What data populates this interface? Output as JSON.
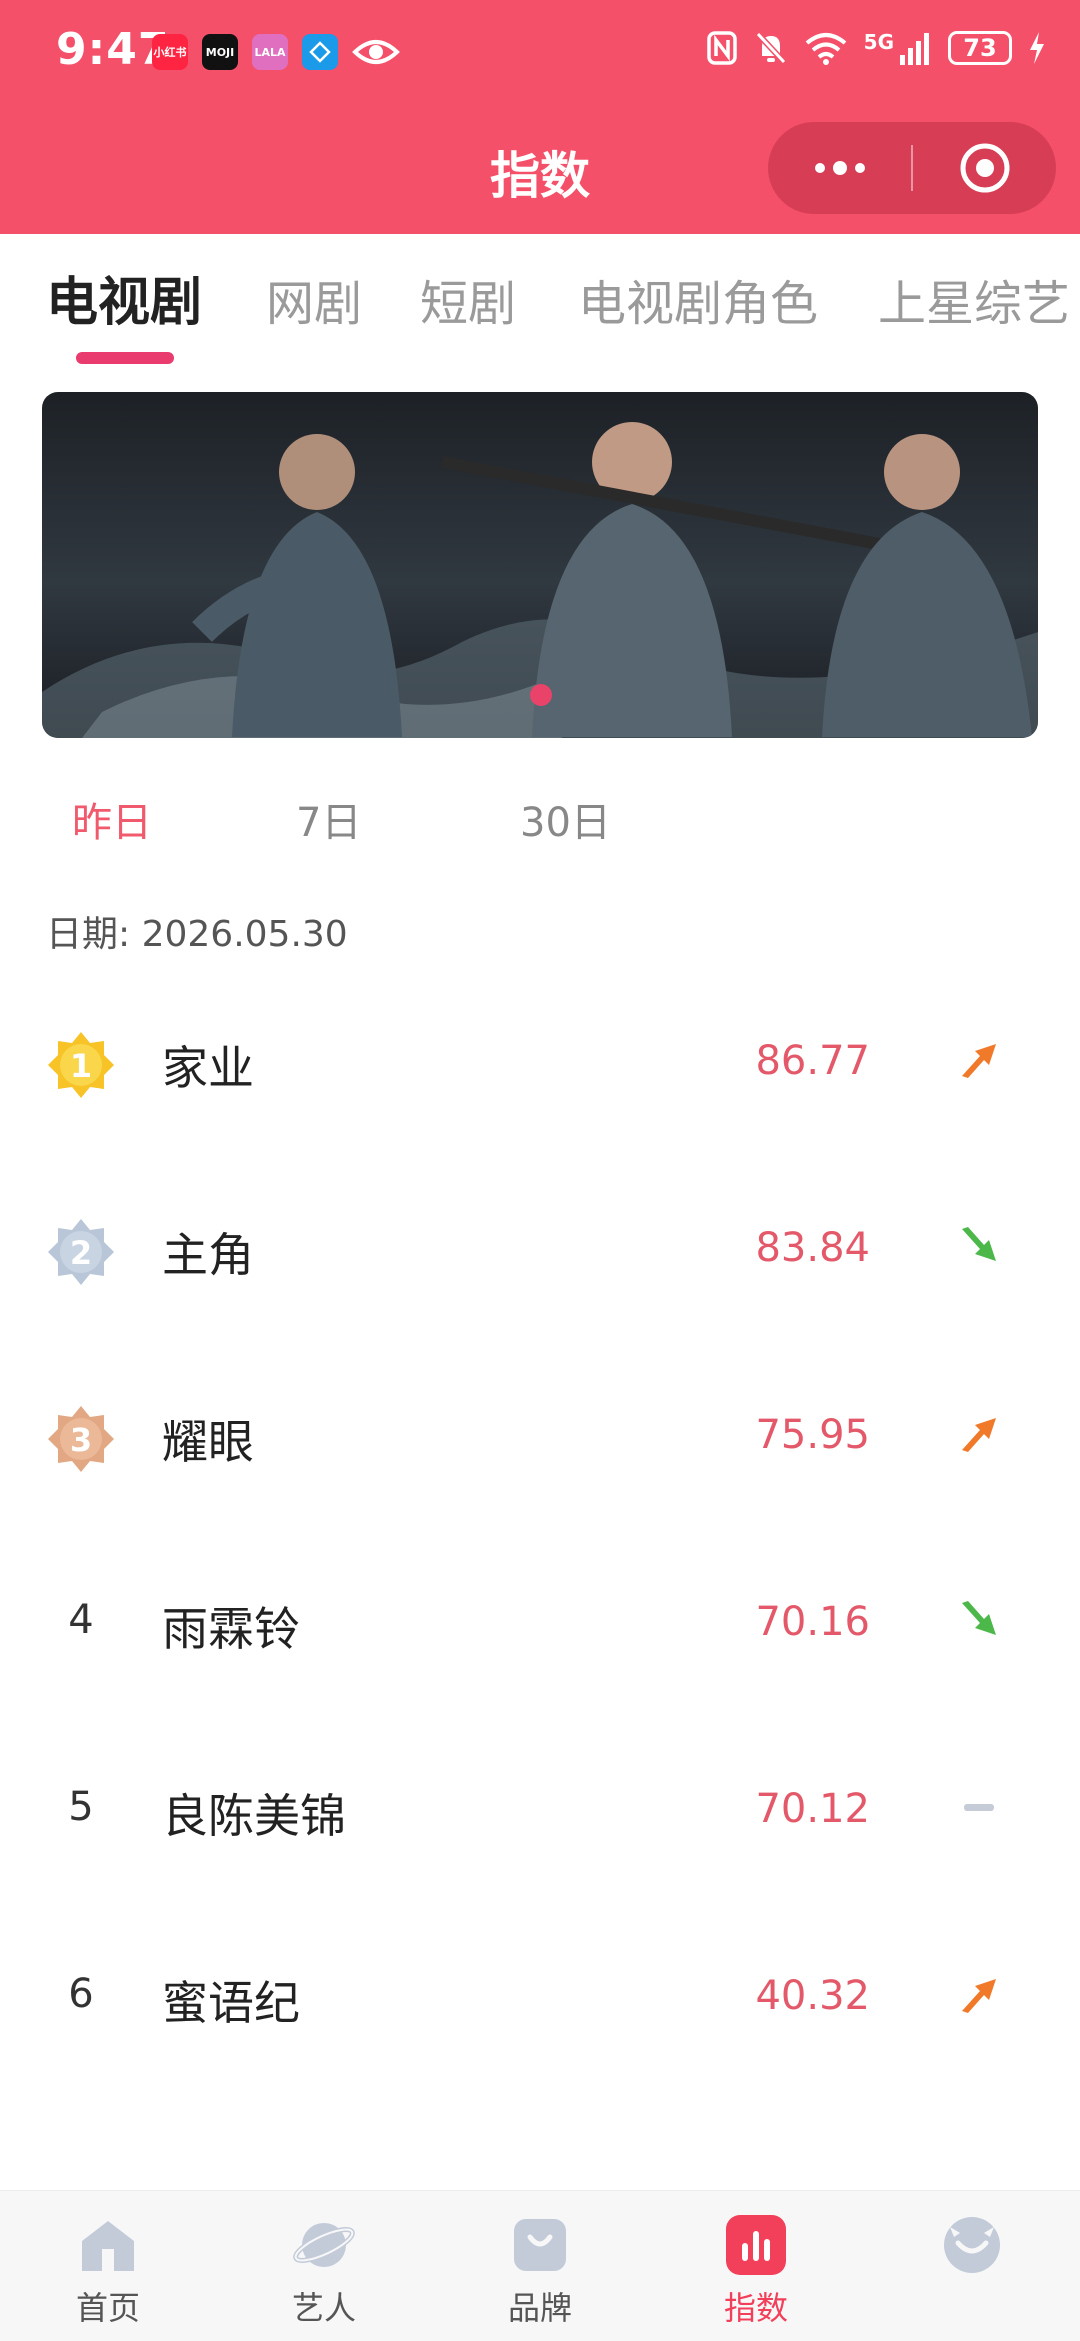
{
  "status_bar": {
    "time": "9:47",
    "notif_apps": [
      {
        "text": "小红书",
        "color": "#ff2442"
      },
      {
        "text": "MOJI",
        "color": "#111111"
      },
      {
        "text": "LALA",
        "color": "#e06fbf"
      },
      {
        "text": "",
        "color": "#1a9ae8"
      }
    ],
    "network": "5G",
    "battery": "73"
  },
  "header": {
    "title": "指数"
  },
  "category_tabs": [
    {
      "label": "电视剧",
      "active": true
    },
    {
      "label": "网剧",
      "active": false
    },
    {
      "label": "短剧",
      "active": false
    },
    {
      "label": "电视剧角色",
      "active": false
    },
    {
      "label": "上星综艺",
      "active": false
    }
  ],
  "period_tabs": [
    {
      "label": "昨日",
      "active": true
    },
    {
      "label": "7日",
      "active": false
    },
    {
      "label": "30日",
      "active": false
    }
  ],
  "date": {
    "label": "日期:",
    "value": "2026.05.30"
  },
  "rankings": [
    {
      "rank": "1",
      "name": "家业",
      "score": "86.77",
      "trend": "up"
    },
    {
      "rank": "2",
      "name": "主角",
      "score": "83.84",
      "trend": "down"
    },
    {
      "rank": "3",
      "name": "耀眼",
      "score": "75.95",
      "trend": "up"
    },
    {
      "rank": "4",
      "name": "雨霖铃",
      "score": "70.16",
      "trend": "down"
    },
    {
      "rank": "5",
      "name": "良陈美锦",
      "score": "70.12",
      "trend": "flat"
    },
    {
      "rank": "6",
      "name": "蜜语纪",
      "score": "40.32",
      "trend": "up"
    }
  ],
  "bottom_nav": [
    {
      "label": "首页",
      "icon": "home-icon",
      "active": false
    },
    {
      "label": "艺人",
      "icon": "planet-icon",
      "active": false
    },
    {
      "label": "品牌",
      "icon": "shopping-bag-icon",
      "active": false
    },
    {
      "label": "指数",
      "icon": "bar-chart-icon",
      "active": true
    },
    {
      "label": "",
      "icon": "profile-icon",
      "active": false
    }
  ],
  "colors": {
    "header": "#f4506a",
    "accent": "#ea3b6e",
    "score": "#e4596a",
    "trend_up": "#f07a2a",
    "trend_down": "#4cb849",
    "trend_flat": "#c5ccd8"
  }
}
